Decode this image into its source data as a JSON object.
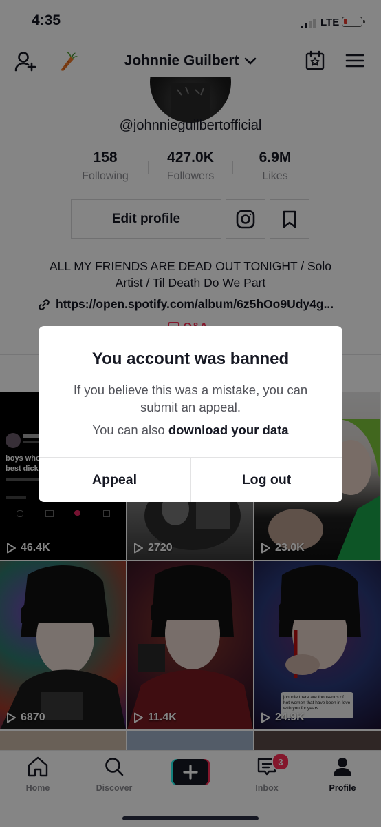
{
  "status_bar": {
    "time": "4:35",
    "network": "LTE"
  },
  "header": {
    "profile_name": "Johnnie Guilbert",
    "icons": [
      "add-user-icon",
      "carrot-icon",
      "calendar-star-icon",
      "menu-icon"
    ]
  },
  "profile": {
    "handle": "@johnnieguilbertofficial",
    "stats": [
      {
        "value": "158",
        "label": "Following"
      },
      {
        "value": "427.0K",
        "label": "Followers"
      },
      {
        "value": "6.9M",
        "label": "Likes"
      }
    ],
    "edit_label": "Edit profile",
    "bio": "ALL MY FRIENDS ARE DEAD OUT TONIGHT / Solo Artist / Til Death Do We Part",
    "link": "https://open.spotify.com/album/6z5hOo9Udy4g...",
    "qa_label": "Q&A"
  },
  "videos": [
    {
      "views": "46.4K",
      "caption": "boys who\nbest dick"
    },
    {
      "views": "2720"
    },
    {
      "views": "23.0K"
    },
    {
      "views": "6870"
    },
    {
      "views": "11.4K"
    },
    {
      "views": "24.9K",
      "overlay_text": "johnnie there are thousands of hot women that have been in love with you for years"
    }
  ],
  "modal": {
    "title": "You account was banned",
    "body": "If you believe this was a mistake, you can submit an appeal.",
    "body2_prefix": "You can also ",
    "body2_link": "download your data",
    "appeal_label": "Appeal",
    "logout_label": "Log out"
  },
  "nav": {
    "home": "Home",
    "discover": "Discover",
    "inbox": "Inbox",
    "inbox_badge": "3",
    "profile": "Profile"
  },
  "colors": {
    "accent": "#fe2c55",
    "text": "#161823",
    "muted": "#8a8b91"
  }
}
